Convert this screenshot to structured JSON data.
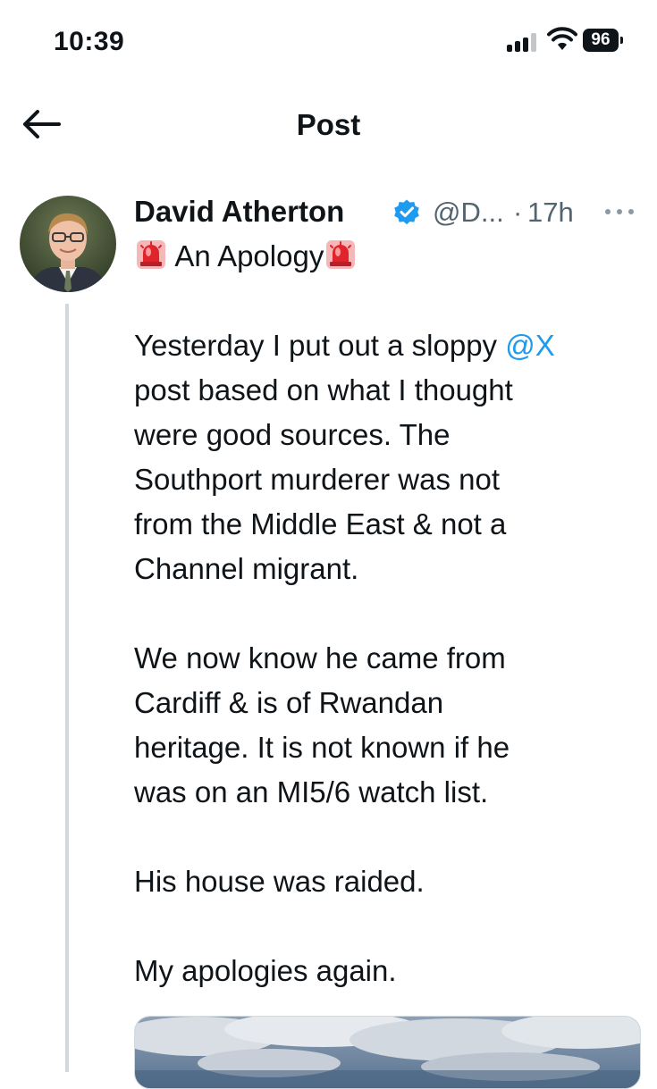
{
  "status_bar": {
    "time": "10:39",
    "battery_level": "96"
  },
  "nav": {
    "title": "Post"
  },
  "post": {
    "author_name": "David Atherton",
    "handle": "@D...",
    "separator": "·",
    "timestamp": "17h",
    "headline": "An Apology",
    "paragraph1_start": "Yesterday I put out a sloppy ",
    "mention": "@X",
    "paragraph1_lines": [
      "post based on what I thought",
      "were good sources. The",
      "Southport murderer was not",
      "from the Middle East & not a",
      "Channel migrant."
    ],
    "paragraph2_lines": [
      "We now know he came from",
      "Cardiff & is of Rwandan",
      "heritage. It is not known if he",
      "was on an MI5/6 watch list."
    ],
    "paragraph3": "His house was raided.",
    "paragraph4": "My apologies again."
  },
  "icons": {
    "back": "arrow-left-icon",
    "verified": "verified-badge-icon",
    "more": "more-horizontal-icon",
    "siren": "police-siren-emoji"
  },
  "colors": {
    "accent": "#1d9bf0",
    "text": "#0f1419",
    "secondary": "#536471",
    "thread_line": "#cfd9de"
  }
}
